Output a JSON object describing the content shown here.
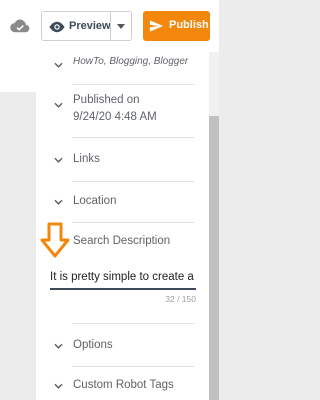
{
  "toolbar": {
    "preview_label": "Preview",
    "publish_label": "Publish",
    "publish_color": "#f3870c"
  },
  "settings": {
    "labels_value": "HowTo, Blogging, Blogger",
    "published_line1": "Published on",
    "published_line2": "9/24/20 4:48 AM",
    "links_label": "Links",
    "location_label": "Location",
    "search_description_label": "Search Description",
    "search_description_value": "It is pretty simple to create a",
    "char_counter": "32 / 150",
    "options_label": "Options",
    "custom_robot_tags_label": "Custom Robot Tags"
  },
  "annotation": {
    "arrow_color": "#f3870c"
  }
}
